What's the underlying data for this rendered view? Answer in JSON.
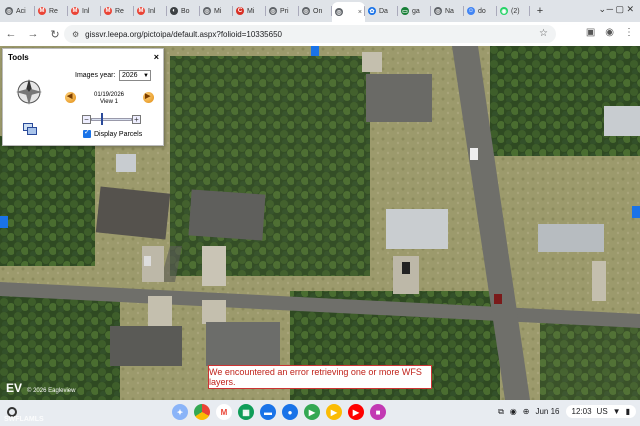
{
  "browser": {
    "tabs": [
      {
        "label": "Aci",
        "fav_color": "#5f6368",
        "fav_glyph": "◎"
      },
      {
        "label": "Re",
        "fav_color": "#ea4335",
        "fav_glyph": "M"
      },
      {
        "label": "Inl",
        "fav_color": "#ea4335",
        "fav_glyph": "M"
      },
      {
        "label": "Re",
        "fav_color": "#ea4335",
        "fav_glyph": "M"
      },
      {
        "label": "Inl",
        "fav_color": "#ea4335",
        "fav_glyph": "M"
      },
      {
        "label": "Bo",
        "fav_color": "#3c4043",
        "fav_glyph": "◐"
      },
      {
        "label": "Mi",
        "fav_color": "#5f6368",
        "fav_glyph": "◎"
      },
      {
        "label": "Mi",
        "fav_color": "#d93025",
        "fav_glyph": "C"
      },
      {
        "label": "Pri",
        "fav_color": "#5f6368",
        "fav_glyph": "◎"
      },
      {
        "label": "On",
        "fav_color": "#5f6368",
        "fav_glyph": "◎"
      },
      {
        "label": "",
        "fav_color": "#5f6368",
        "fav_glyph": "◎",
        "active": true
      },
      {
        "label": "Da",
        "fav_color": "#1a73e8",
        "fav_glyph": "✿"
      },
      {
        "label": "ga",
        "fav_color": "#188038",
        "fav_glyph": "▭"
      },
      {
        "label": "Na",
        "fav_color": "#5f6368",
        "fav_glyph": "◎"
      },
      {
        "label": "do",
        "fav_color": "#4285f4",
        "fav_glyph": "☺"
      },
      {
        "label": "(2)",
        "fav_color": "#25d366",
        "fav_glyph": "◉"
      }
    ],
    "new_tab": "+",
    "url": "gissvr.leepa.org/pictoipa/default.aspx?folioid=10335650"
  },
  "tools_panel": {
    "title": "Tools",
    "close": "×",
    "images_year_label": "Images year:",
    "year_value": "2026",
    "date": "01/19/2026",
    "view": "View 1",
    "display_parcels_label": "Display Parcels",
    "display_parcels_checked": true,
    "zoom_level_fraction": 0.28
  },
  "map": {
    "error_message": "We encountered an error retrieving one or more WFS layers.",
    "copyright": "© 2026 Eagleview",
    "logo": "EV"
  },
  "shelf": {
    "date": "Jun 16",
    "time": "12:03",
    "region": "US"
  },
  "watermark": "SWFLAMLS",
  "colors": {
    "error_text": "#c0221a",
    "accent": "#1a73e8"
  }
}
